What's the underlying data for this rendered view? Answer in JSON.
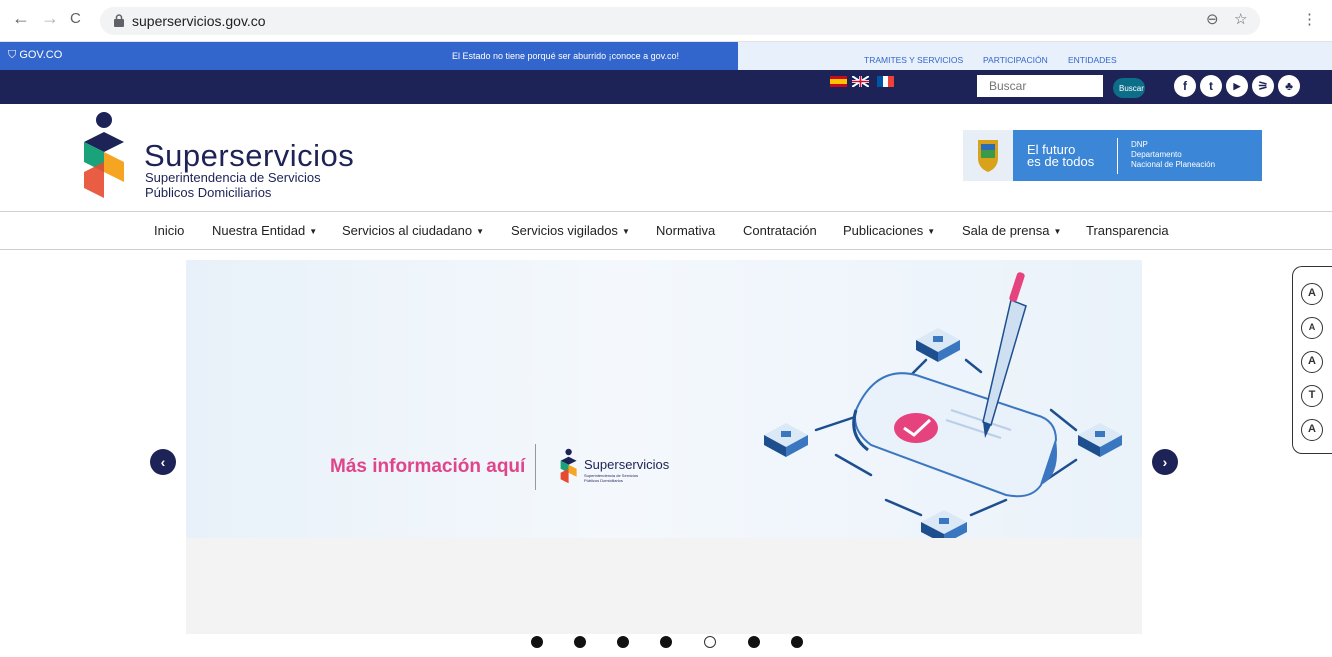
{
  "browser": {
    "url": "superservicios.gov.co",
    "back_glyph": "←",
    "forward_glyph": "→",
    "reload_glyph": "C",
    "zoom_glyph": "⊖",
    "star_glyph": "☆",
    "menu_glyph": "⋮"
  },
  "gov_bar": {
    "logo_text": "GOV.CO",
    "tagline": "El Estado no tiene porqué ser aburrido ¡conoce a gov.co!",
    "links": [
      "TRAMITES Y SERVICIOS",
      "PARTICIPACIÓN",
      "ENTIDADES"
    ]
  },
  "top_bar": {
    "search_placeholder": "Buscar",
    "search_button": "Buscar",
    "social": [
      {
        "icon": "facebook-icon",
        "glyph": "f"
      },
      {
        "icon": "twitter-icon",
        "glyph": "t"
      },
      {
        "icon": "youtube-icon",
        "glyph": "▶"
      },
      {
        "icon": "rss-icon",
        "glyph": "⚞"
      },
      {
        "icon": "sitemap-icon",
        "glyph": "♣"
      }
    ]
  },
  "header": {
    "brand_name": "Superservicios",
    "brand_sub1": "Superintendencia de Servicios",
    "brand_sub2": "Públicos Domiciliarios",
    "dnp_slogan_line1": "El futuro",
    "dnp_slogan_line2": "es de todos",
    "dnp_abbr": "DNP",
    "dnp_name_line1": "Departamento",
    "dnp_name_line2": "Nacional de Planeación"
  },
  "menu": {
    "items": [
      {
        "label": "Inicio",
        "dropdown": false
      },
      {
        "label": "Nuestra Entidad",
        "dropdown": true
      },
      {
        "label": "Servicios al ciudadano",
        "dropdown": true
      },
      {
        "label": "Servicios vigilados",
        "dropdown": true
      },
      {
        "label": "Normativa",
        "dropdown": false
      },
      {
        "label": "Contratación",
        "dropdown": false
      },
      {
        "label": "Publicaciones",
        "dropdown": true
      },
      {
        "label": "Sala de prensa",
        "dropdown": true
      },
      {
        "label": "Transparencia",
        "dropdown": false
      }
    ],
    "caret_glyph": "▼"
  },
  "slider": {
    "headline": "Más información aquí",
    "brand": "Superservicios",
    "brand_sub_line1": "Superintendencia de Servicios",
    "brand_sub_line2": "Públicos Domiciliarios",
    "prev_glyph": "‹",
    "next_glyph": "›",
    "dot_count": 7,
    "active_dot": 4
  },
  "accessibility": [
    {
      "icon": "contrast-icon",
      "glyph": "A"
    },
    {
      "icon": "font-reset-icon",
      "glyph": "A"
    },
    {
      "icon": "font-decrease-icon",
      "glyph": "A"
    },
    {
      "icon": "font-type-icon",
      "glyph": "T"
    },
    {
      "icon": "font-increase-icon",
      "glyph": "A"
    }
  ],
  "colors": {
    "navy": "#1d2356",
    "gov_blue": "#3366cc",
    "pink": "#e0458b",
    "dnp_blue": "#3b86d6"
  }
}
